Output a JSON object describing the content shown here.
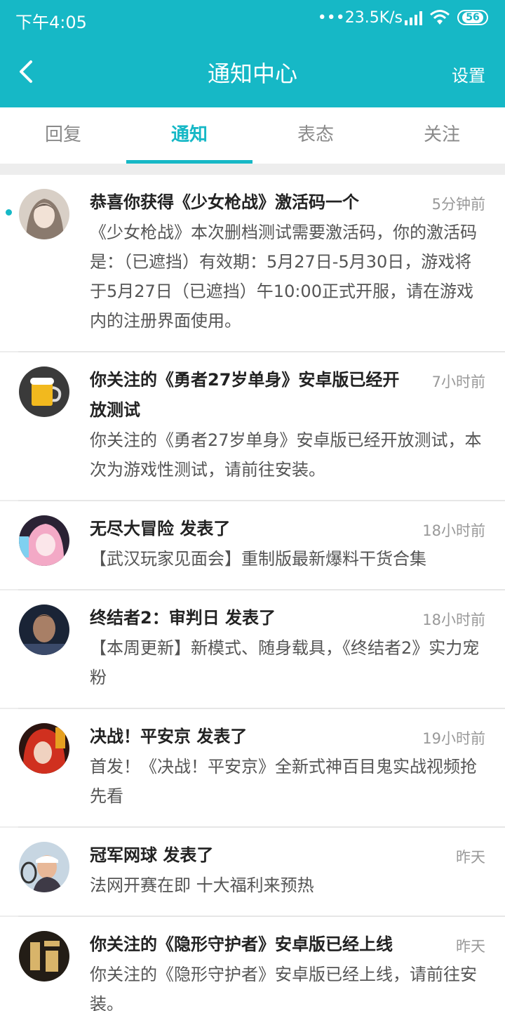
{
  "status_bar": {
    "time": "下午4:05",
    "network_speed": "•••23.5K/s",
    "battery_level": "56"
  },
  "header": {
    "title": "通知中心",
    "settings_label": "设置"
  },
  "tabs": [
    {
      "label": "回复"
    },
    {
      "label": "通知"
    },
    {
      "label": "表态"
    },
    {
      "label": "关注"
    }
  ],
  "selected_tab": "通知",
  "colors": {
    "accent": "#16b8c6"
  },
  "notifications": [
    {
      "title": "恭喜你获得《少女枪战》激活码一个",
      "time": "5分钟前",
      "body": "《少女枪战》本次删档测试需要激活码，你的激活码是：（已遮挡）有效期：5月27日-5月30日，游戏将于5月27日（已遮挡）午10:00正式开服，请在游戏内的注册界面使用。",
      "unread": true
    },
    {
      "title": "你关注的《勇者27岁单身》安卓版已经开放测试",
      "time": "7小时前",
      "body": "你关注的《勇者27岁单身》安卓版已经开放测试，本次为游戏性测试，请前往安装。",
      "unread": false
    },
    {
      "title": "无尽大冒险 发表了",
      "time": "18小时前",
      "body": "【武汉玩家见面会】重制版最新爆料干货合集",
      "unread": false
    },
    {
      "title": "终结者2：审判日 发表了",
      "time": "18小时前",
      "body": "【本周更新】新模式、随身载具，《终结者2》实力宠粉",
      "unread": false
    },
    {
      "title": "决战！平安京 发表了",
      "time": "19小时前",
      "body": "首发！《决战！平安京》全新式神百目鬼实战视频抢先看",
      "unread": false
    },
    {
      "title": "冠军网球 发表了",
      "time": "昨天",
      "body": "法网开赛在即 十大福利来预热",
      "unread": false
    },
    {
      "title": "你关注的《隐形守护者》安卓版已经上线",
      "time": "昨天",
      "body": "你关注的《隐形守护者》安卓版已经上线，请前往安装。",
      "unread": false
    }
  ]
}
